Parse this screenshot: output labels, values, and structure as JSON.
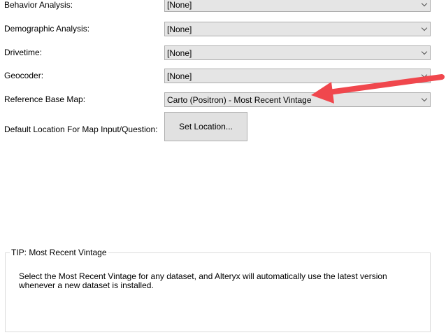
{
  "fields": [
    {
      "label": "Behavior Analysis:",
      "value": "[None]"
    },
    {
      "label": "Demographic Analysis:",
      "value": "[None]"
    },
    {
      "label": "Drivetime:",
      "value": "[None]"
    },
    {
      "label": "Geocoder:",
      "value": "[None]"
    },
    {
      "label": "Reference Base Map:",
      "value": "Carto (Positron) - Most Recent Vintage"
    }
  ],
  "location": {
    "label": "Default Location For Map Input/Question:",
    "button": "Set Location..."
  },
  "tip": {
    "title": "TIP: Most Recent Vintage",
    "text": "Select the Most Recent Vintage for any dataset, and Alteryx will automatically use the latest version whenever a new dataset is installed."
  },
  "colors": {
    "arrow": "#f0474d"
  }
}
